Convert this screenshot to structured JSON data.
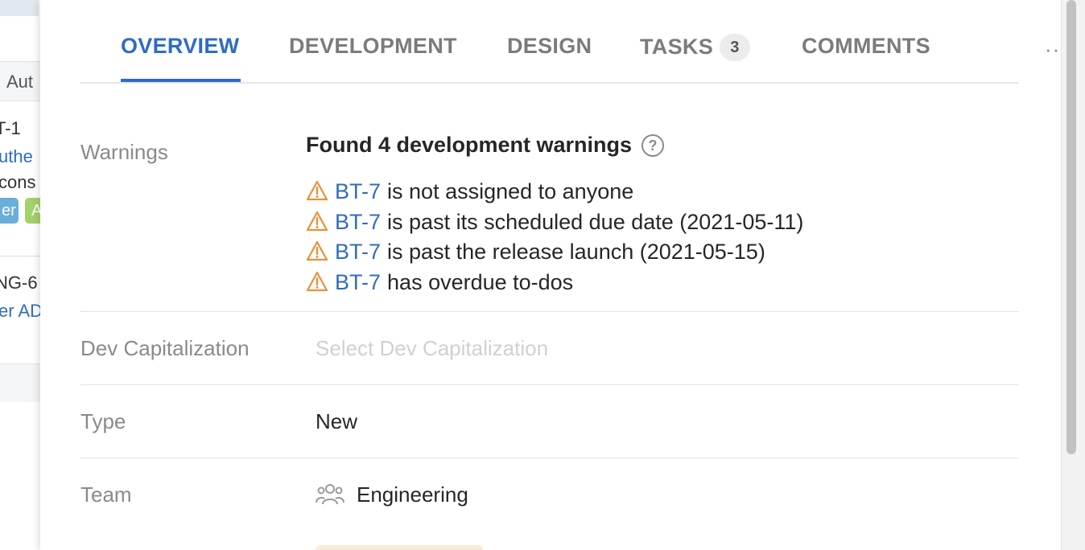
{
  "background": {
    "column_header": "Aut",
    "row1": {
      "key": "T-1",
      "link": "uthe",
      "text": "cons",
      "chips": [
        "er",
        "A"
      ]
    },
    "row2": {
      "key": "NG-6",
      "link": "er AD"
    }
  },
  "tabs": [
    {
      "label": "OVERVIEW",
      "active": true
    },
    {
      "label": "DEVELOPMENT",
      "active": false
    },
    {
      "label": "DESIGN",
      "active": false
    },
    {
      "label": "TASKS",
      "active": false,
      "badge": "3"
    },
    {
      "label": "COMMENTS",
      "active": false
    }
  ],
  "more_label": "···",
  "warnings": {
    "label": "Warnings",
    "title": "Found 4 development warnings",
    "help": "?",
    "items": [
      {
        "issue": "BT-7",
        "text": "is not assigned to anyone"
      },
      {
        "issue": "BT-7",
        "text": "is past its scheduled due date (2021-05-11)"
      },
      {
        "issue": "BT-7",
        "text": "is past the release launch (2021-05-15)"
      },
      {
        "issue": "BT-7",
        "text": "has overdue to-dos"
      }
    ]
  },
  "dev_capitalization": {
    "label": "Dev Capitalization",
    "placeholder": "Select Dev Capitalization"
  },
  "type": {
    "label": "Type",
    "value": "New"
  },
  "team": {
    "label": "Team",
    "value": "Engineering",
    "icon": "people-icon"
  },
  "colors": {
    "accent": "#2f6cc2",
    "warning": "#e8913a",
    "muted": "#8a8a8a"
  }
}
